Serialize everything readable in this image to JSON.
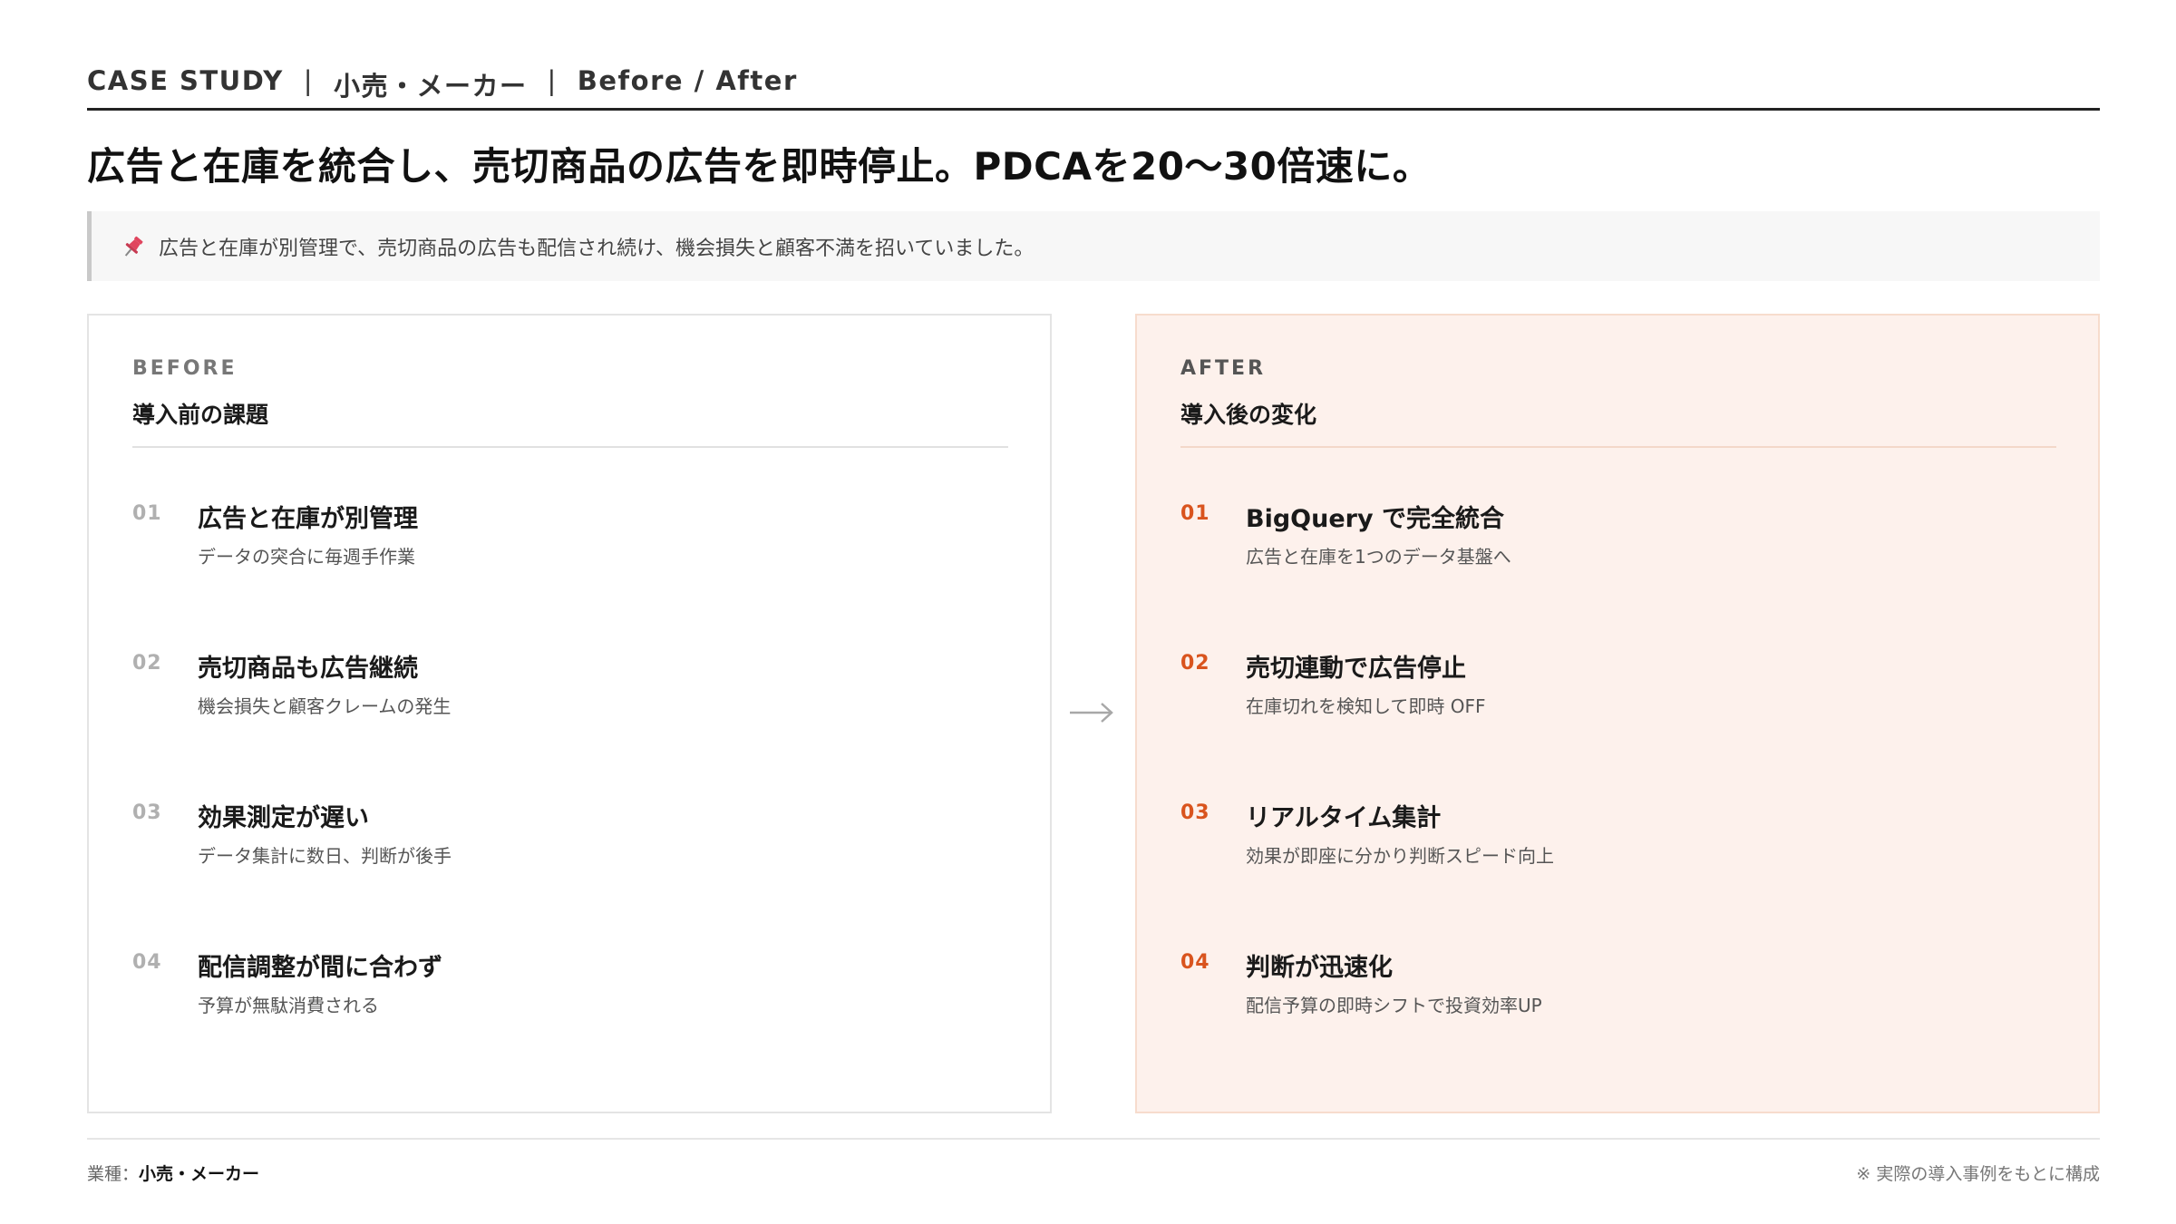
{
  "header": {
    "label1": "CASE STUDY",
    "sep1": "|",
    "label2": "小売・メーカー",
    "sep2": "|",
    "label3": "Before / After"
  },
  "headline": "広告と在庫を統合し、売切商品の広告を即時停止。PDCAを20〜30倍速に。",
  "note": {
    "icon": "pushpin-icon",
    "text": "広告と在庫が別管理で、売切商品の広告も配信され続け、機会損失と顧客不満を招いていました。"
  },
  "before": {
    "tag": "BEFORE",
    "title": "導入前の課題",
    "items": [
      {
        "num": "01",
        "title": "広告と在庫が別管理",
        "desc": "データの突合に毎週手作業"
      },
      {
        "num": "02",
        "title": "売切商品も広告継続",
        "desc": "機会損失と顧客クレームの発生"
      },
      {
        "num": "03",
        "title": "効果測定が遅い",
        "desc": "データ集計に数日、判断が後手"
      },
      {
        "num": "04",
        "title": "配信調整が間に合わず",
        "desc": "予算が無駄消費される"
      }
    ]
  },
  "after": {
    "tag": "AFTER",
    "title": "導入後の変化",
    "items": [
      {
        "num": "01",
        "title": "BigQuery で完全統合",
        "desc": "広告と在庫を1つのデータ基盤へ"
      },
      {
        "num": "02",
        "title": "売切連動で広告停止",
        "desc": "在庫切れを検知して即時 OFF"
      },
      {
        "num": "03",
        "title": "リアルタイム集計",
        "desc": "効果が即座に分かり判断スピード向上"
      },
      {
        "num": "04",
        "title": "判断が迅速化",
        "desc": "配信予算の即時シフトで投資効率UP"
      }
    ]
  },
  "footer": {
    "industry_label": "業種：",
    "industry_value": "小売・メーカー",
    "note": "※ 実際の導入事例をもとに構成"
  },
  "colors": {
    "accent": "#d9541e",
    "after_bg": "#fdf1ec",
    "pin": "#e0455e"
  }
}
